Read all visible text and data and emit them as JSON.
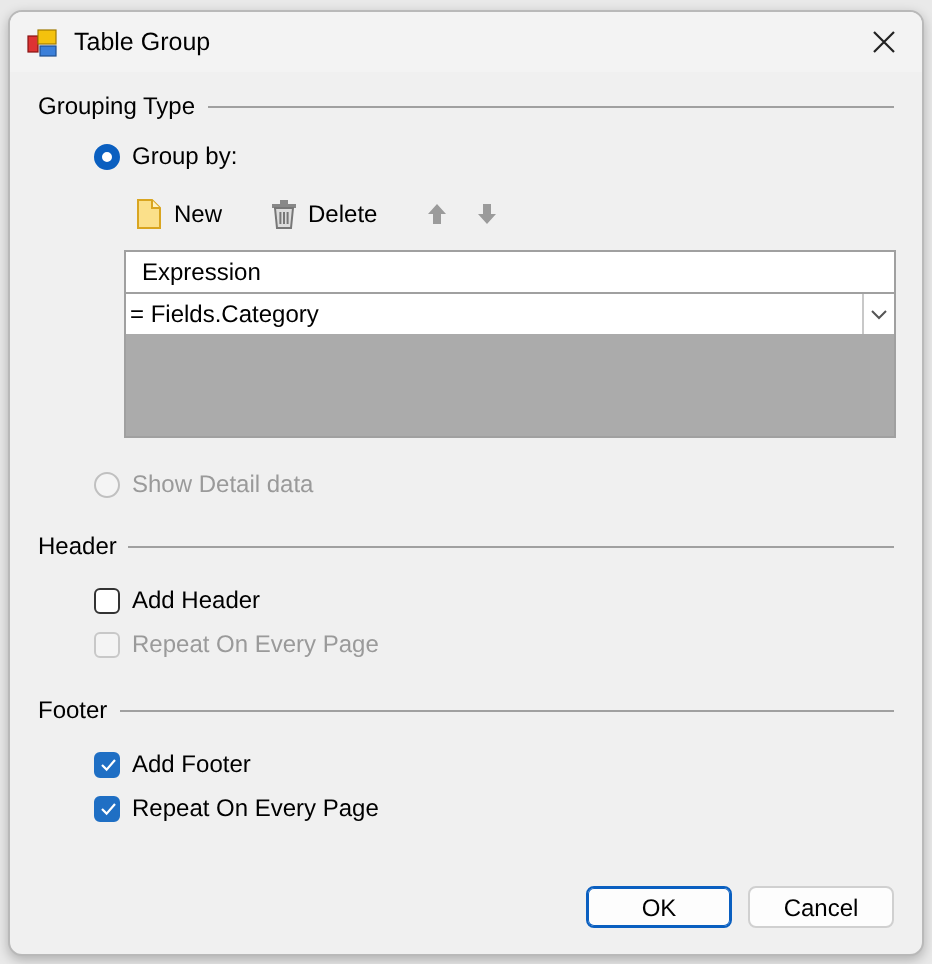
{
  "window": {
    "title": "Table Group"
  },
  "grouping_type": {
    "label": "Grouping Type",
    "options": [
      {
        "label": "Group by:",
        "selected": true,
        "disabled": false
      },
      {
        "label": "Show Detail data",
        "selected": false,
        "disabled": true
      }
    ],
    "toolbar": [
      {
        "kind": "new",
        "label": "New",
        "disabled": false
      },
      {
        "kind": "delete",
        "label": "Delete",
        "disabled": false
      },
      {
        "kind": "up",
        "disabled": true
      },
      {
        "kind": "down",
        "disabled": true
      }
    ],
    "grid": {
      "columns": [
        "Expression"
      ],
      "rows": [
        {
          "value": "= Fields.Category"
        }
      ]
    }
  },
  "header": {
    "label": "Header",
    "options": [
      {
        "label": "Add Header",
        "checked": false,
        "disabled": false
      },
      {
        "label": "Repeat On Every Page",
        "checked": false,
        "disabled": true
      }
    ]
  },
  "footer": {
    "label": "Footer",
    "options": [
      {
        "label": "Add Footer",
        "checked": true,
        "disabled": false
      },
      {
        "label": "Repeat On Every Page",
        "checked": true,
        "disabled": false
      }
    ]
  },
  "buttons": [
    {
      "label": "OK",
      "default": true
    },
    {
      "label": "Cancel",
      "default": false
    }
  ]
}
